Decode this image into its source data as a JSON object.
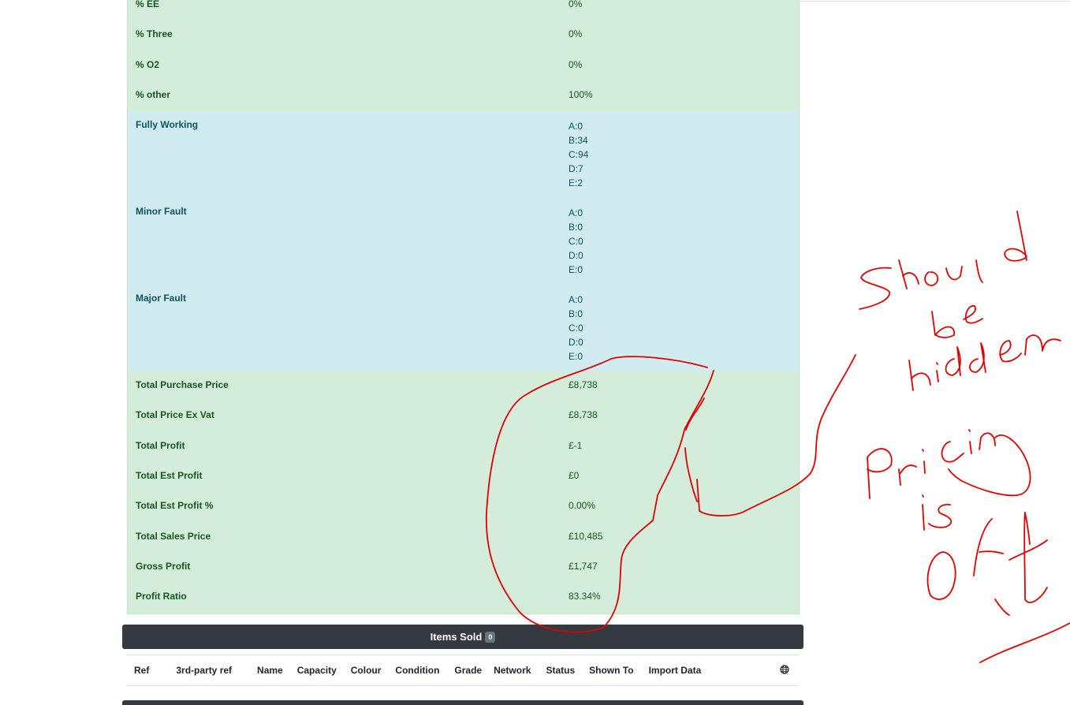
{
  "details": {
    "rows_top": [
      {
        "label": "% EE",
        "value": "0%"
      },
      {
        "label": "% Three",
        "value": "0%"
      },
      {
        "label": "% O2",
        "value": "0%"
      },
      {
        "label": "% other",
        "value": "100%"
      }
    ],
    "grades": [
      {
        "label": "Fully Working",
        "values": [
          "A:0",
          "B:34",
          "C:94",
          "D:7",
          "E:2"
        ]
      },
      {
        "label": "Minor Fault",
        "values": [
          "A:0",
          "B:0",
          "C:0",
          "D:0",
          "E:0"
        ]
      },
      {
        "label": "Major Fault",
        "values": [
          "A:0",
          "B:0",
          "C:0",
          "D:0",
          "E:0"
        ]
      }
    ],
    "totals": [
      {
        "label": "Total Purchase Price",
        "value": "£8,738"
      },
      {
        "label": "Total Price Ex Vat",
        "value": "£8,738"
      },
      {
        "label": "Total Profit",
        "value": "£-1"
      },
      {
        "label": "Total Est Profit",
        "value": "£0"
      },
      {
        "label": "Total Est Profit %",
        "value": "0.00%"
      },
      {
        "label": "Total Sales Price",
        "value": "£10,485"
      },
      {
        "label": "Gross Profit",
        "value": "£1,747"
      },
      {
        "label": "Profit Ratio",
        "value": "83.34%"
      }
    ]
  },
  "items_sold": {
    "title": "Items Sold",
    "count": "0",
    "columns": [
      "Ref",
      "3rd-party ref",
      "Name",
      "Capacity",
      "Colour",
      "Condition",
      "Grade",
      "Network",
      "Status",
      "Shown To",
      "Import Data"
    ],
    "globe_icon": "globe-icon"
  },
  "annotation": {
    "color": "#e00000",
    "note_lines": [
      "Should",
      "be",
      "hidden",
      "Pricing",
      "is",
      "off"
    ]
  }
}
